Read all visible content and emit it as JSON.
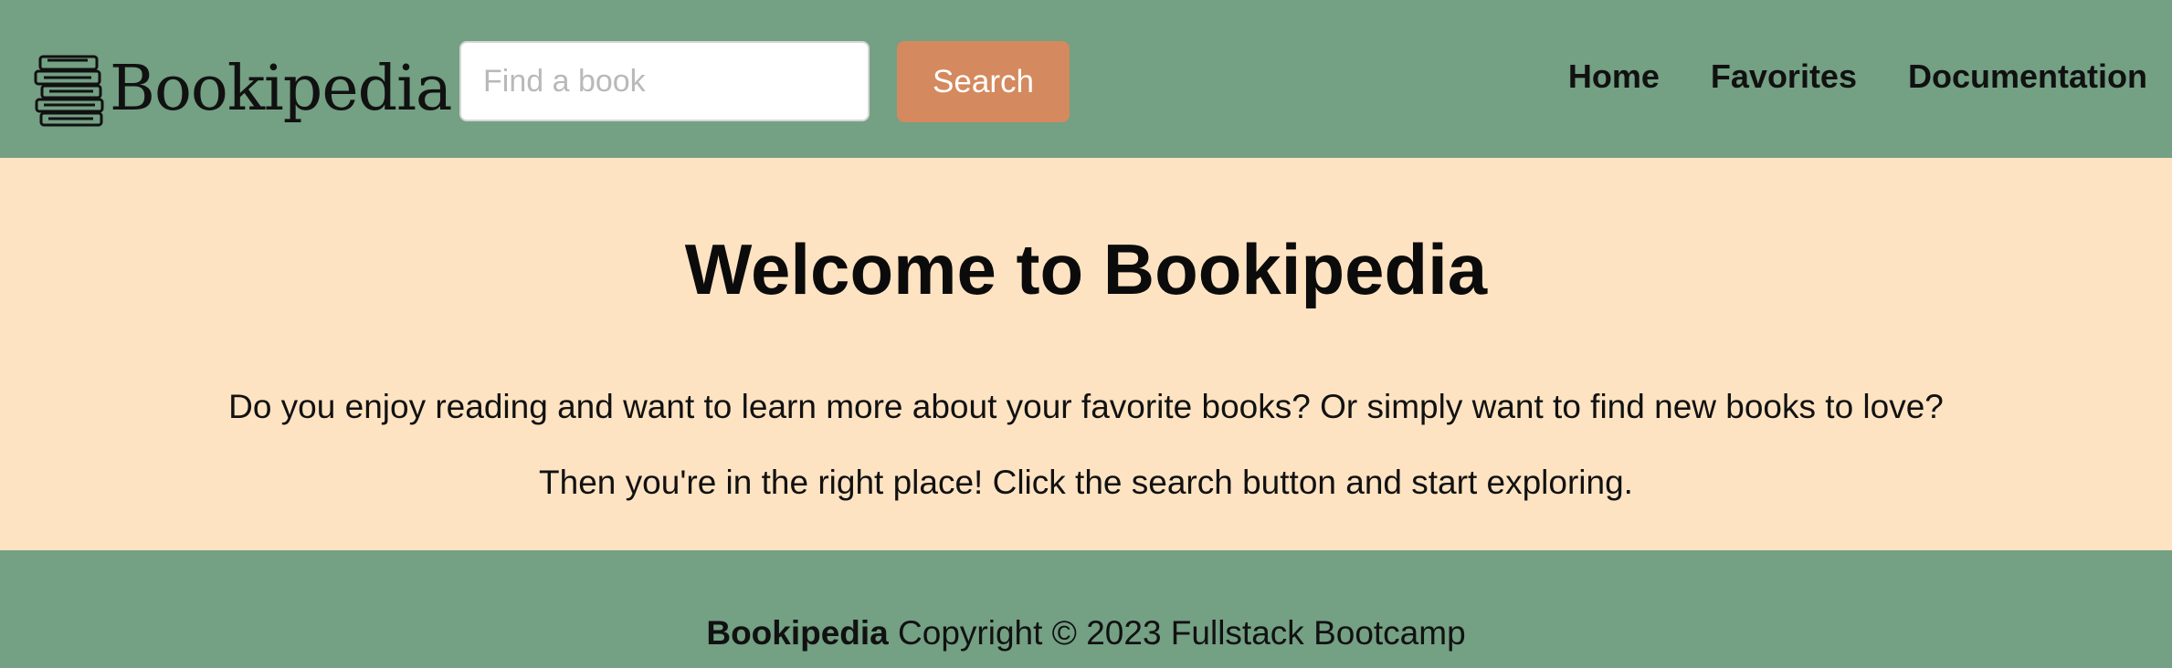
{
  "header": {
    "logo_text": "Bookipedia",
    "search": {
      "placeholder": "Find a book",
      "value": "",
      "button_label": "Search"
    },
    "nav": [
      {
        "label": "Home"
      },
      {
        "label": "Favorites"
      },
      {
        "label": "Documentation"
      }
    ]
  },
  "main": {
    "title": "Welcome to Bookipedia",
    "paragraphs": [
      "Do you enjoy reading and want to learn more about your favorite books? Or simply want to find new books to love?",
      "Then you're in the right place! Click the search button and start exploring."
    ]
  },
  "footer": {
    "brand": "Bookipedia",
    "copyright": " Copyright © 2023 Fullstack Bootcamp"
  },
  "colors": {
    "header_bg": "#74a084",
    "page_bg": "#fee3c2",
    "search_button_bg": "#d4895e"
  }
}
